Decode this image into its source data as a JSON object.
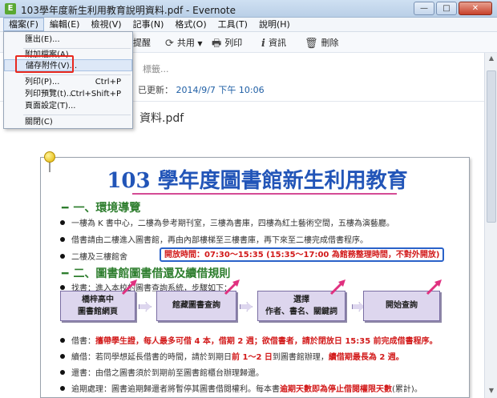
{
  "window": {
    "title": "103學年度新生利用教育說明資料.pdf - Evernote",
    "controls": {
      "minimize": "—",
      "maximize": "□",
      "close": "✕"
    }
  },
  "menubar": [
    {
      "label": "檔案(F)"
    },
    {
      "label": "編輯(E)"
    },
    {
      "label": "檢視(V)"
    },
    {
      "label": "記事(N)"
    },
    {
      "label": "格式(O)"
    },
    {
      "label": "工具(T)"
    },
    {
      "label": "說明(H)"
    }
  ],
  "file_menu": {
    "items": [
      {
        "label": "匯出(E)...",
        "shortcut": ""
      },
      {
        "label": "附加檔案(A)",
        "shortcut": ""
      },
      {
        "label": "儲存附件(V)...",
        "shortcut": ""
      },
      {
        "label": "列印(P)...",
        "shortcut": "Ctrl+P"
      },
      {
        "label": "列印預覽(t)...",
        "shortcut": "Ctrl+Shift+P"
      },
      {
        "label": "頁面設定(T)...",
        "shortcut": ""
      },
      {
        "label": "關閉(C)",
        "shortcut": ""
      }
    ]
  },
  "toolbar": {
    "reminder": "提醒",
    "share": "共用",
    "print": "列印",
    "info": "資訊",
    "delete": "刪除"
  },
  "note": {
    "tag_hint": "標籤...",
    "updated_prefix": "已更新：",
    "updated_time": "2014/9/7 下午 10:06",
    "attachment_name": "資料.pdf"
  },
  "pdf": {
    "title": "103 學年度圖書館新生利用教育",
    "section1": "一、環境導覽",
    "s1_line1": "一樓為 K 書中心，二樓為參考期刊室，三樓為書庫，四樓為紅土藝術空間，五樓為演藝廳。",
    "s1_line2": "借書請由二樓進入圖書館，再由內部樓梯至三樓書庫，再下來至二樓完成借書程序。",
    "s1_line3": "二樓及三樓館舍",
    "hours": "開放時間：07:30～15:35 (15:35～17:00 為館務整理時間，不對外開放)",
    "section2": "二、圖書館圖書借還及續借規則",
    "s2_intro": "找書：進入本校的圖書查詢系統，步驟如下：",
    "flow": [
      {
        "line1": "橋梓高中",
        "line2": "圖書館網頁"
      },
      {
        "line1": "館藏圖書查詢",
        "line2": ""
      },
      {
        "line1": "選擇",
        "line2": "作者、書名、關鍵詞"
      },
      {
        "line1": "開始查詢",
        "line2": ""
      }
    ],
    "rule_borrow_prefix": "借書：",
    "rule_borrow_red": "攜帶學生證，每人最多可借 4 本，借期 2 週；欲借書者，請於閉放日 15:35 前完成借書程序。",
    "rule_renew_prefix": "續借：若同學想延長借書的時間，請於到期日",
    "rule_renew_red1": "前 1～2 日",
    "rule_renew_mid": "到圖書館辦理，",
    "rule_renew_red2": "續借期最長為 2 週。",
    "rule_return": "還書：由借之圖書須於到期前至圖書館櫃台辦理歸還。",
    "rule_overdue_prefix": "逾期處理：圖書逾期歸還者將暫停其圖書借閱權利。每本書",
    "rule_overdue_red": "逾期天數即為停止借閱權限天數",
    "rule_overdue_suffix": "(累計)。"
  }
}
